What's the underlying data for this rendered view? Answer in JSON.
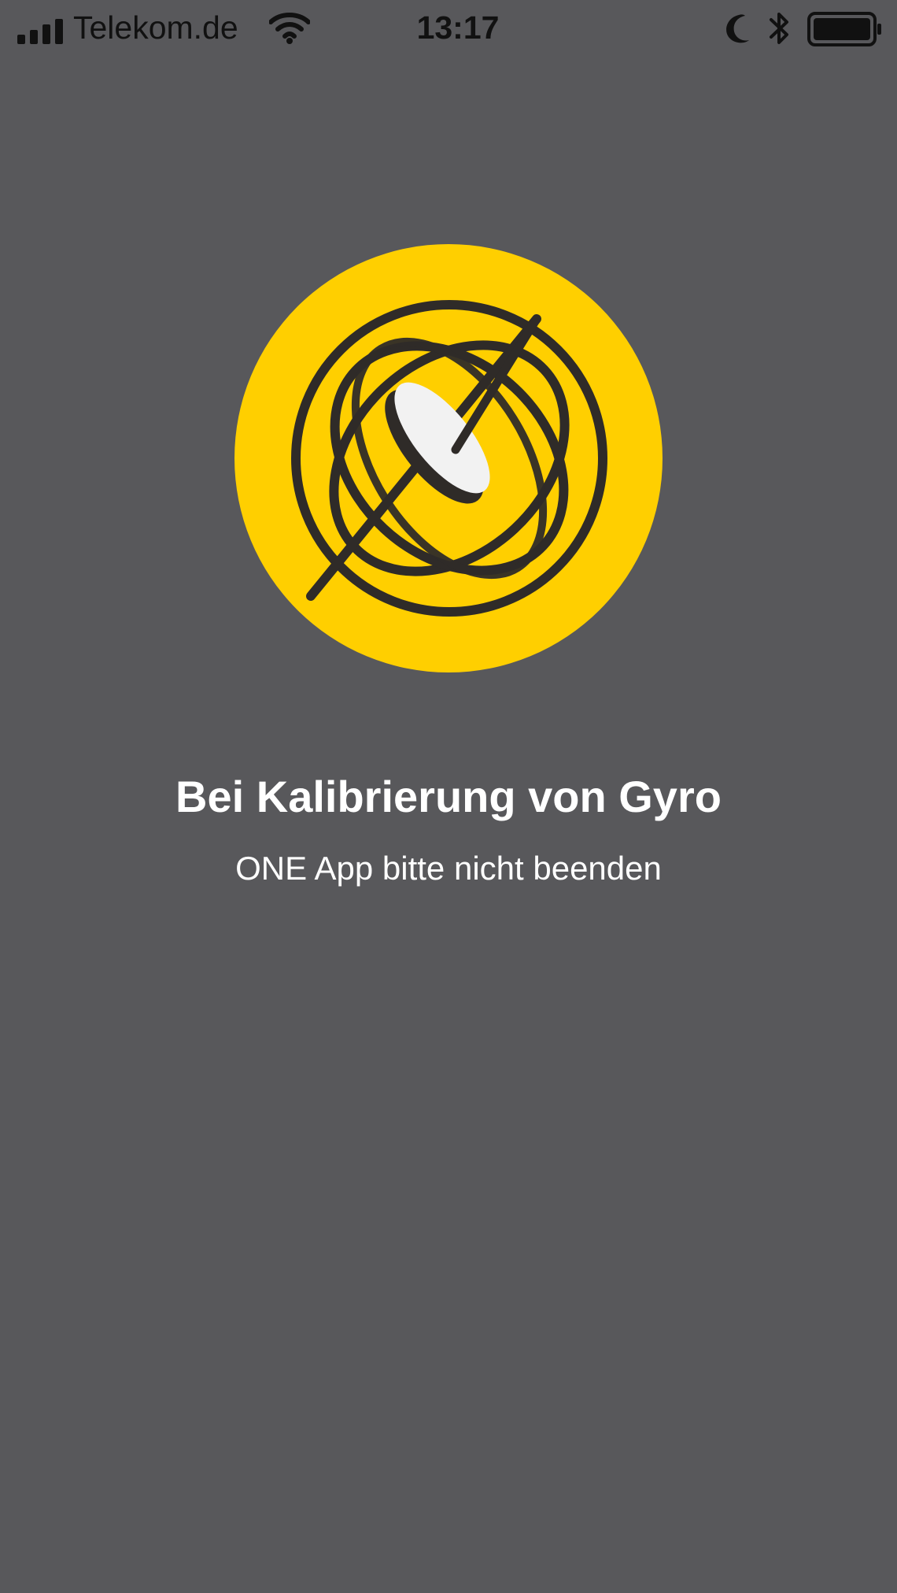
{
  "status_bar": {
    "carrier": "Telekom.de",
    "time": "13:17",
    "icons": {
      "signal": "cellular-signal-icon",
      "wifi": "wifi-icon",
      "do_not_disturb": "moon-icon",
      "bluetooth": "bluetooth-icon",
      "battery": "battery-icon"
    }
  },
  "calibration": {
    "icon": "gyroscope-icon",
    "title": "Bei Kalibrierung von Gyro",
    "subtitle": "ONE App bitte nicht beenden",
    "colors": {
      "background": "#58585b",
      "accent": "#ffcf00",
      "line": "#2f2b28",
      "disk": "#f2f2f2"
    }
  }
}
